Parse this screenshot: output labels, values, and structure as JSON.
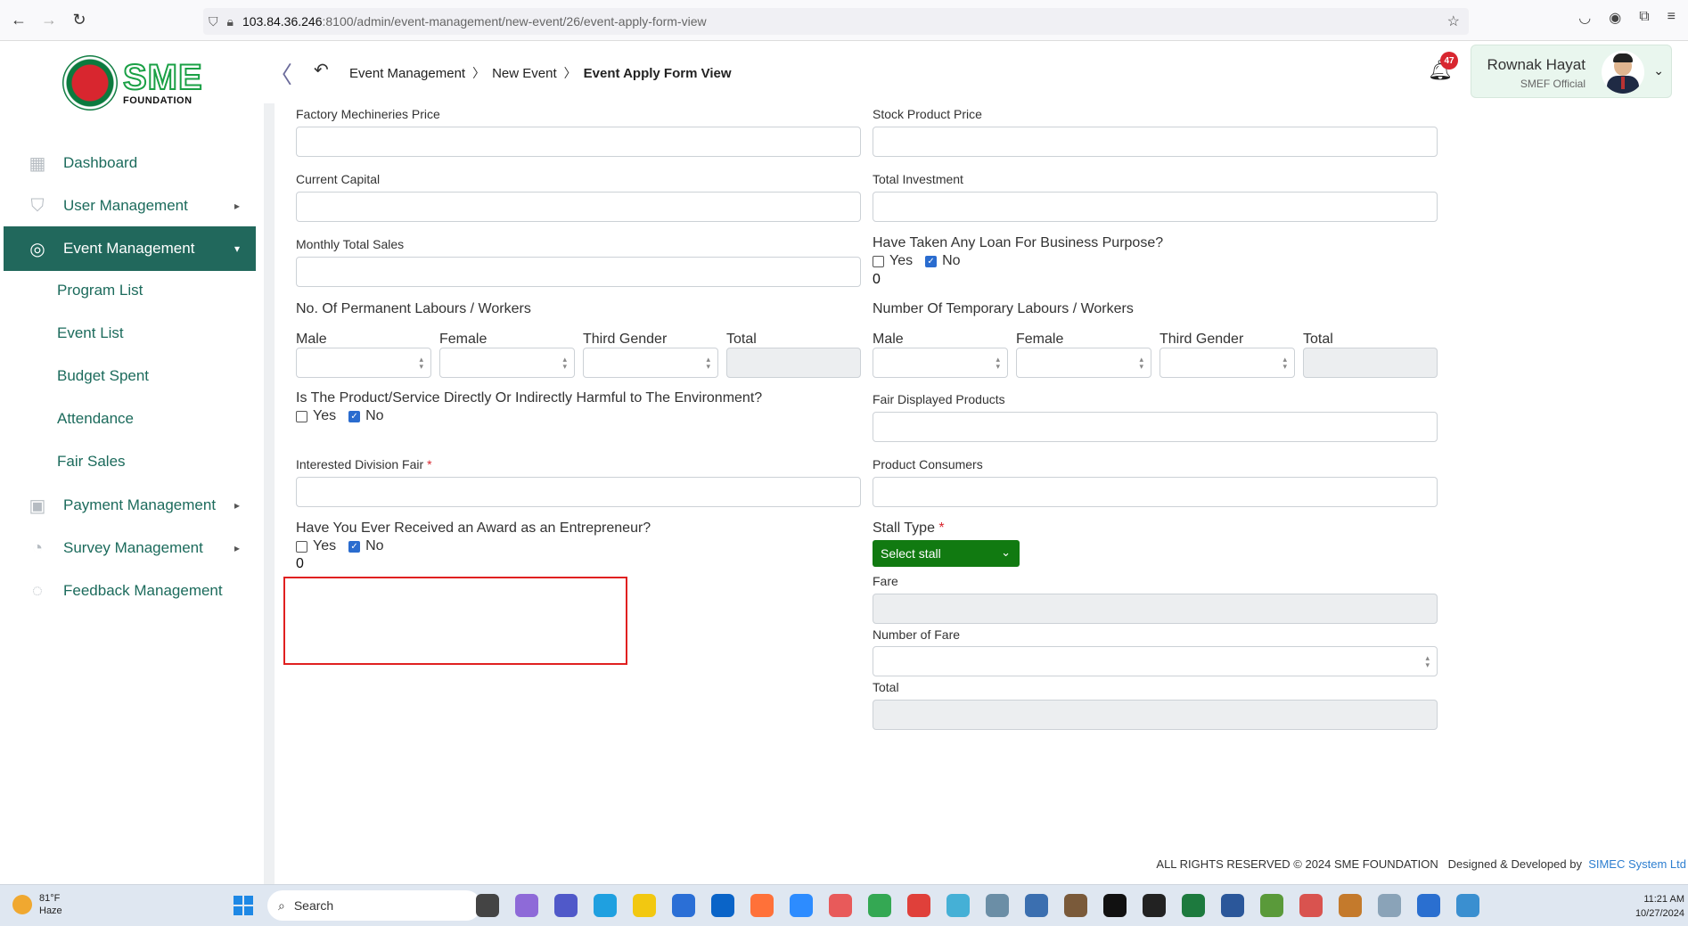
{
  "browser": {
    "url_host": "103.84.36.246",
    "url_path": ":8100/admin/event-management/new-event/26/event-apply-form-view"
  },
  "logo": {
    "brand": "SME",
    "sub": "FOUNDATION"
  },
  "sidebar": {
    "items": [
      {
        "label": "Dashboard",
        "icon": "grid-icon"
      },
      {
        "label": "User Management",
        "icon": "shield-user-icon"
      },
      {
        "label": "Event Management",
        "icon": "lock-circle-icon"
      },
      {
        "label": "Payment Management",
        "icon": "money-icon"
      },
      {
        "label": "Survey Management",
        "icon": "pie-chart-icon"
      },
      {
        "label": "Feedback Management",
        "icon": "feedback-icon"
      }
    ],
    "sub_items": [
      "Program List",
      "Event List",
      "Budget Spent",
      "Attendance",
      "Fair Sales"
    ]
  },
  "header": {
    "breadcrumb": [
      "Event Management",
      "New Event",
      "Event Apply Form View"
    ],
    "notification_count": "47",
    "user_name": "Rownak Hayat",
    "user_role": "SMEF Official"
  },
  "form": {
    "factory_mechineries_price": "Factory Mechineries Price",
    "stock_product_price": "Stock Product Price",
    "current_capital": "Current Capital",
    "total_investment": "Total Investment",
    "monthly_total_sales": "Monthly Total Sales",
    "loan_question": "Have Taken Any Loan For Business Purpose?",
    "loan_value": "0",
    "permanent_labours": "No. Of Permanent Labours / Workers",
    "temporary_labours": "Number Of Temporary Labours / Workers",
    "male": "Male",
    "female": "Female",
    "third_gender": "Third Gender",
    "total": "Total",
    "harmful_question": "Is The Product/Service Directly Or Indirectly Harmful to The Environment?",
    "fair_displayed_products": "Fair Displayed Products",
    "interested_division_fair": "Interested Division Fair",
    "product_consumers": "Product Consumers",
    "award_question": "Have You Ever Received an Award as an Entrepreneur?",
    "award_value": "0",
    "stall_type": "Stall Type",
    "select_stall": "Select stall",
    "fare": "Fare",
    "number_of_fare": "Number of Fare",
    "total_label": "Total",
    "yes": "Yes",
    "no": "No",
    "required_mark": "*"
  },
  "footer": {
    "rights": "ALL RIGHTS RESERVED © 2024 SME FOUNDATION",
    "designed": "Designed & Developed by",
    "company": "SIMEC System Ltd"
  },
  "taskbar": {
    "temp": "81°F",
    "weather": "Haze",
    "search_placeholder": "Search",
    "time": "11:21 AM",
    "date": "10/27/2024"
  }
}
